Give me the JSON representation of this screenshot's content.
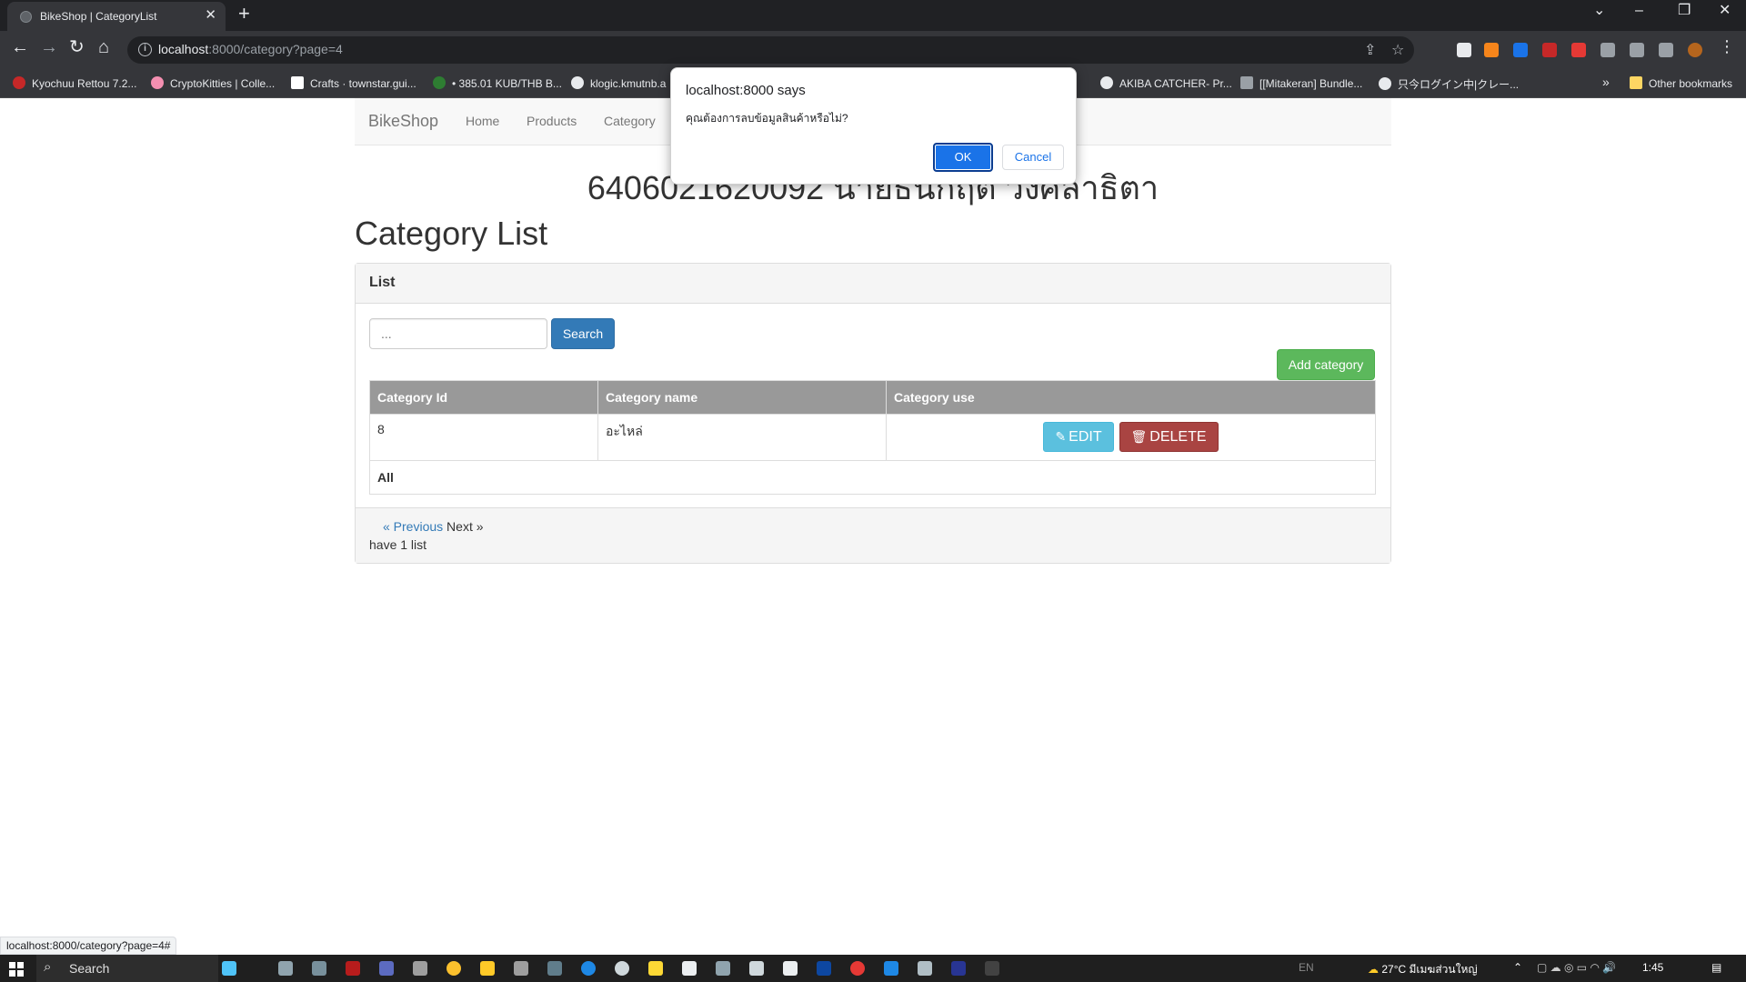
{
  "browser": {
    "tab_title": "BikeShop | CategoryList",
    "tab_close": "✕",
    "new_tab": "+",
    "url_host": "localhost",
    "url_path": ":8000/category?page=4",
    "bookmarks": [
      "Kyochuu Rettou 7.2...",
      "CryptoKitties | Colle...",
      "Crafts · townstar.gui...",
      "• 385.01 KUB/THB B...",
      "klogic.kmutnb.a",
      "...",
      "AKIBA CATCHER- Pr...",
      "[[Mitakeran] Bundle...",
      "只今ログイン中|クレー..."
    ],
    "bookmarks_more": "»",
    "other_bookmarks": "Other bookmarks"
  },
  "navbar": {
    "brand": "BikeShop",
    "links": [
      "Home",
      "Products",
      "Category"
    ]
  },
  "page": {
    "student": "6406021620092 นายธนกฤต วงศ์ลาธิตา",
    "title": "Category List"
  },
  "panel": {
    "heading": "List",
    "search_placeholder": "...",
    "search_button": "Search",
    "add_button": "Add category",
    "columns": [
      "Category Id",
      "Category name",
      "Category use"
    ],
    "rows": [
      {
        "id": "8",
        "name": "อะไหล่",
        "edit": "EDIT",
        "delete": "DELETE"
      }
    ],
    "all_label": "All",
    "pager_prev": "« Previous",
    "pager_next": "Next »",
    "count_text": "have 1 list"
  },
  "dialog": {
    "title": "localhost:8000 says",
    "message": "คุณต้องการลบข้อมูลสินค้าหรือไม่?",
    "ok": "OK",
    "cancel": "Cancel"
  },
  "status_url": "localhost:8000/category?page=4#",
  "taskbar": {
    "search": "Search",
    "weather": "27°C  มีเมฆส่วนใหญ่",
    "lang": "EN",
    "time": "1:45"
  },
  "colors": {
    "primary": "#337ab7",
    "success": "#5cb85c",
    "info": "#5bc0de",
    "danger": "#a94442",
    "table_head": "#999999",
    "dialog_ok": "#1a73e8"
  }
}
